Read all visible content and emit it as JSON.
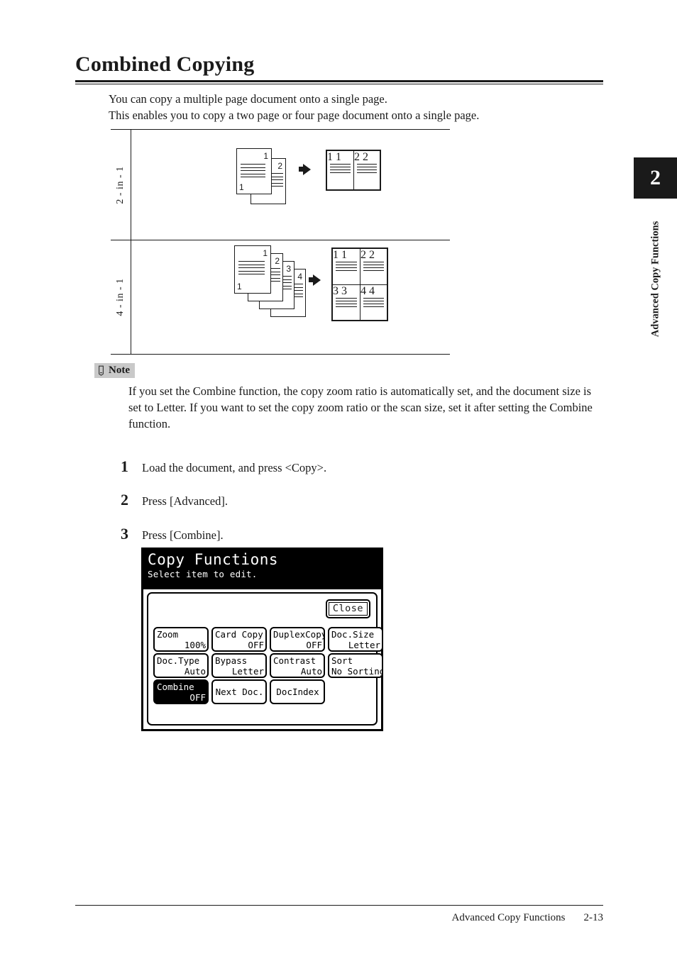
{
  "document": {
    "title": "Combined Copying",
    "intro_lines": [
      "You can copy a multiple page document onto a single page.",
      "This enables you to copy a two page or four page document onto a single page."
    ]
  },
  "diagram": {
    "rows": [
      {
        "label": "2 - in - 1",
        "source_pages": [
          "1",
          "2"
        ],
        "output_cells": [
          "1",
          "2"
        ],
        "output_layout": "1x2"
      },
      {
        "label": "4 - in - 1",
        "source_pages": [
          "1",
          "2",
          "3",
          "4"
        ],
        "output_cells": [
          "1",
          "2",
          "3",
          "4"
        ],
        "output_layout": "2x2"
      }
    ],
    "arrow_icon": "right-arrow-icon"
  },
  "note": {
    "icon": "note-pencil-icon",
    "label": "Note",
    "text": "If you set the Combine function, the copy zoom ratio is automatically set, and the document size is set to Letter. If you want to set the copy zoom ratio or the scan size, set it after setting the Combine function."
  },
  "steps": [
    {
      "number": "1",
      "text": "Load the document, and press <Copy>."
    },
    {
      "number": "2",
      "text": "Press [Advanced]."
    },
    {
      "number": "3",
      "text": "Press [Combine]."
    }
  ],
  "lcd": {
    "title": "Copy Functions",
    "subtitle": "Select item to edit.",
    "close_label": "Close",
    "buttons": [
      {
        "label": "Zoom",
        "value": "100%",
        "selected": false
      },
      {
        "label": "Card Copy",
        "value": "OFF",
        "selected": false
      },
      {
        "label": "DuplexCopy",
        "value": "OFF",
        "selected": false
      },
      {
        "label": "Doc.Size",
        "value": "Letter",
        "selected": false
      },
      {
        "label": "Doc.Type",
        "value": "Auto",
        "selected": false
      },
      {
        "label": "Bypass",
        "value": "Letter",
        "selected": false
      },
      {
        "label": "Contrast",
        "value": "Auto",
        "selected": false
      },
      {
        "label": "Sort",
        "value": "No Sorting",
        "selected": false
      },
      {
        "label": "Combine",
        "value": "OFF",
        "selected": true
      },
      {
        "label": "Next Doc.",
        "value": "",
        "selected": false
      },
      {
        "label": "DocIndex",
        "value": "",
        "selected": false
      }
    ]
  },
  "chapter_tab": {
    "number": "2",
    "title": "Advanced Copy Functions"
  },
  "footer": {
    "section": "Advanced Copy Functions",
    "page": "2-13"
  },
  "colors": {
    "text": "#1a1a1a",
    "lcd_background": "#ffffff",
    "lcd_header": "#000000",
    "note_badge": "#c9c9c9"
  }
}
